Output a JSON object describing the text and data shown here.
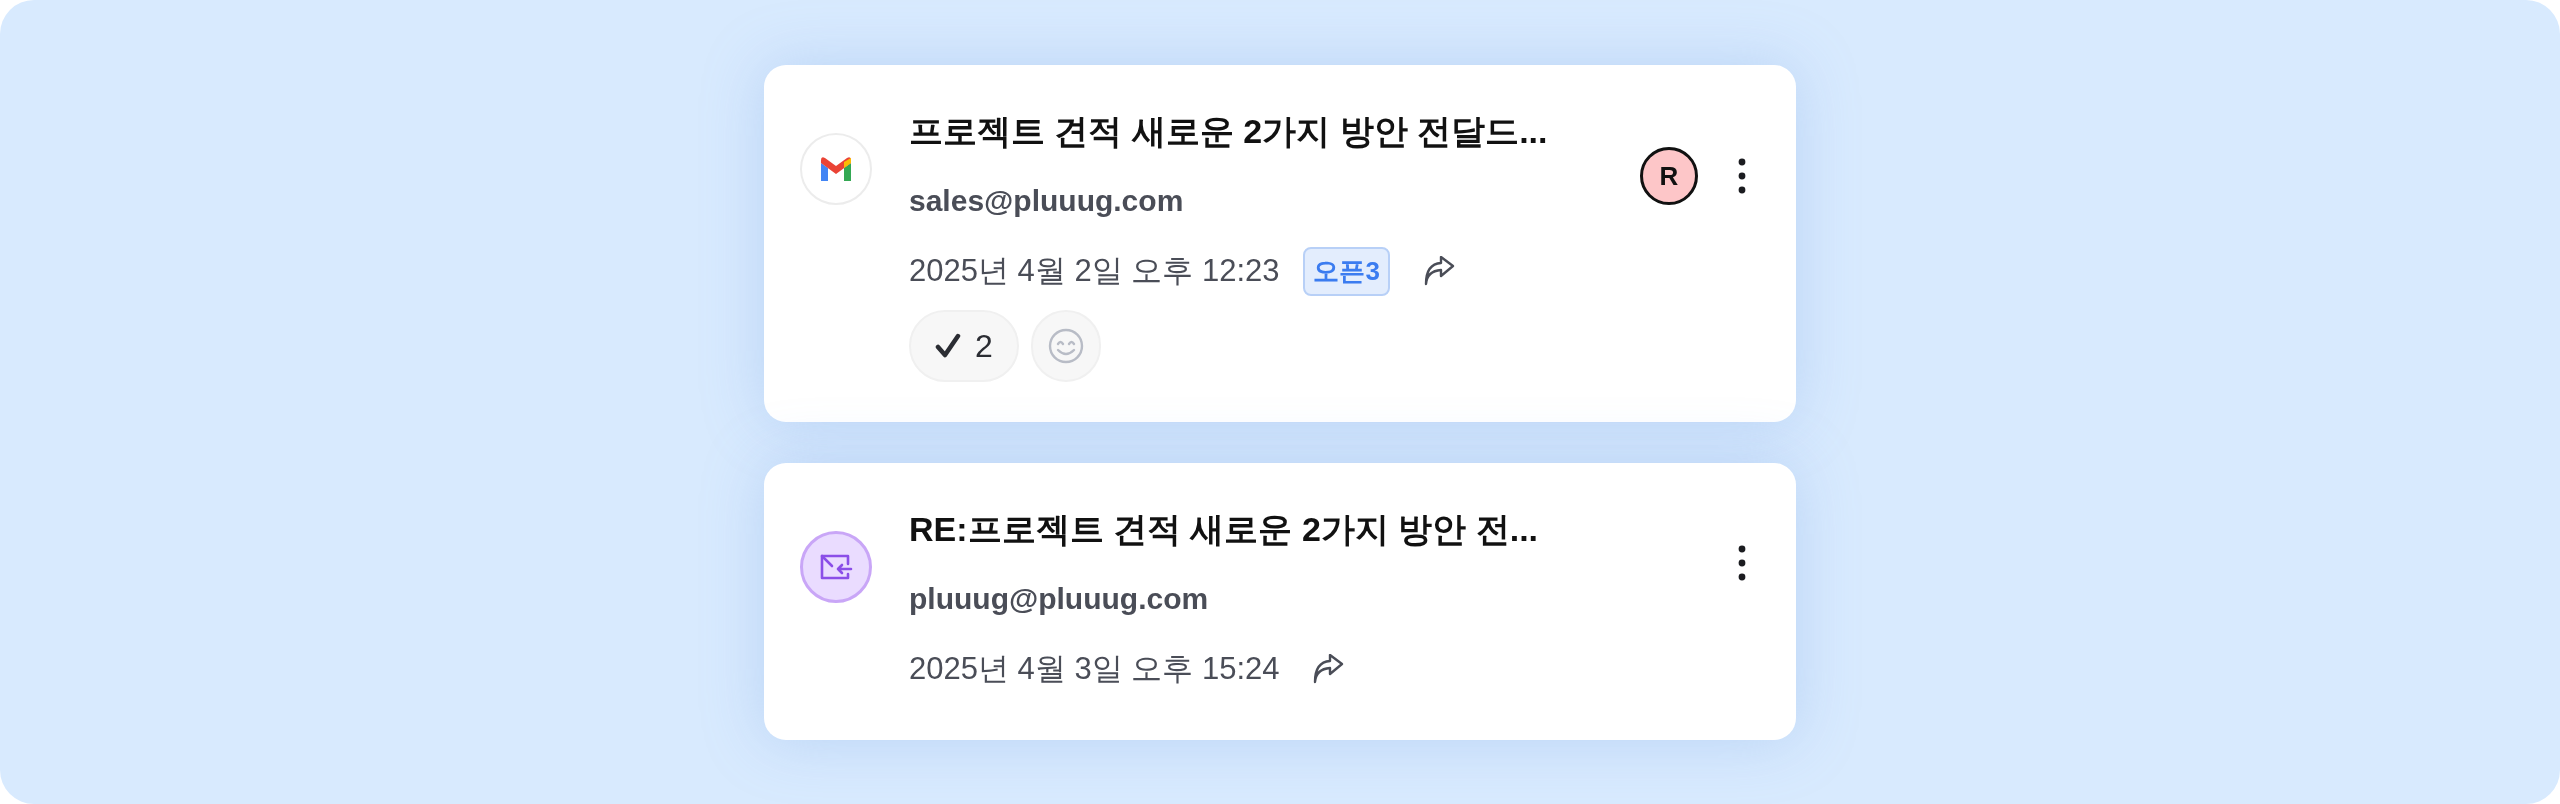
{
  "emails": [
    {
      "kind": "gmail",
      "subject": "프로젝트 견적 새로운 2가지 방안 전달드...",
      "sender": "sales@pluuug.com",
      "date": "2025년 4월 2일 오후 12:23",
      "badge": "오픈3",
      "assignee": "R",
      "reactions": [
        {
          "kind": "check",
          "count": "2"
        },
        {
          "kind": "add-emoji"
        }
      ]
    },
    {
      "kind": "reply",
      "subject": "RE:프로젝트 견적 새로운 2가지 방안 전...",
      "sender": "pluuug@pluuug.com",
      "date": "2025년 4월 3일 오후 15:24"
    }
  ]
}
